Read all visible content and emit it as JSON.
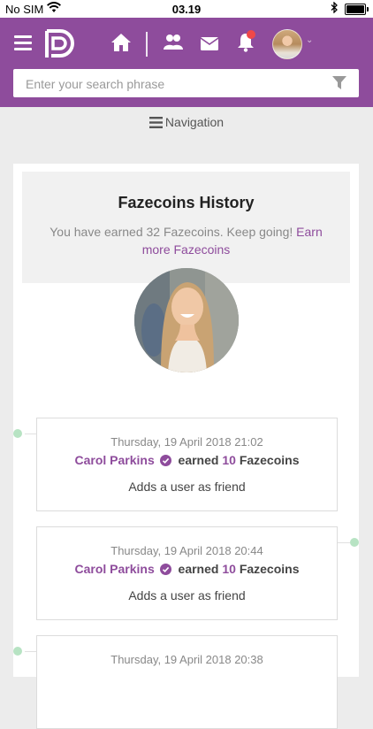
{
  "statusbar": {
    "carrier": "No SIM",
    "time": "03.19"
  },
  "header": {
    "search_placeholder": "Enter your search phrase",
    "accent_color": "#8e4c9c",
    "notification_dot_color": "#f04848"
  },
  "nav": {
    "label": "Navigation"
  },
  "history": {
    "title": "Fazecoins History",
    "text": "You have earned 32 Fazecoins. Keep going!",
    "link": "Earn more Fazecoins"
  },
  "entries": [
    {
      "date": "Thursday, 19 April 2018 21:02",
      "user": "Carol Parkins",
      "earned": "earned",
      "amount": "10",
      "unit": "Fazecoins",
      "description": "Adds a user as friend"
    },
    {
      "date": "Thursday, 19 April 2018 20:44",
      "user": "Carol Parkins",
      "earned": "earned",
      "amount": "10",
      "unit": "Fazecoins",
      "description": "Adds a user as friend"
    },
    {
      "date": "Thursday, 19 April 2018 20:38",
      "user": "",
      "earned": "",
      "amount": "",
      "unit": "",
      "description": ""
    }
  ]
}
